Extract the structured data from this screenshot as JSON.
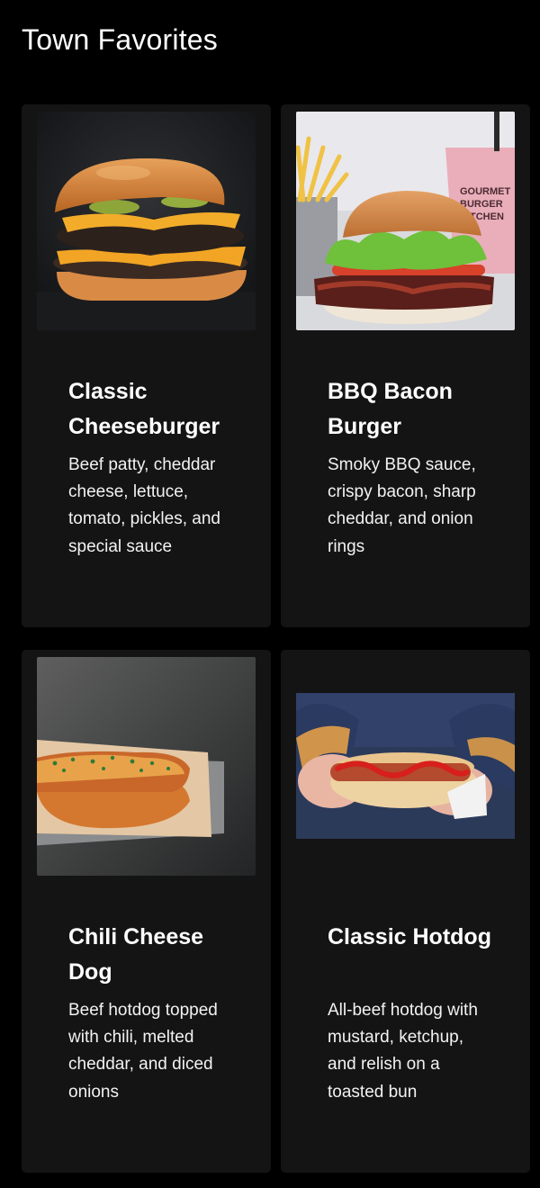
{
  "header": {
    "title": "Town Favorites"
  },
  "items": [
    {
      "title": "Classic Cheeseburger",
      "description": "Beef patty, cheddar cheese, lettuce, tomato, pickles, and special sauce",
      "image_icon": "cheeseburger-photo"
    },
    {
      "title": "BBQ Bacon Burger",
      "description": "Smoky BBQ sauce, crispy bacon, sharp cheddar, and onion rings",
      "image_icon": "bbq-bacon-burger-photo",
      "image_text": "GOURMET BURGER KITCHEN"
    },
    {
      "title": "Chili Cheese Dog",
      "description": "Beef hotdog topped with chili, melted cheddar, and diced onions",
      "image_icon": "chili-cheese-dog-photo"
    },
    {
      "title": "Classic Hotdog",
      "description": "All-beef hotdog with mustard, ketchup, and relish on a toasted bun",
      "image_icon": "classic-hotdog-photo"
    }
  ],
  "colors": {
    "background": "#000000",
    "card": "#141414",
    "text": "#ffffff"
  }
}
